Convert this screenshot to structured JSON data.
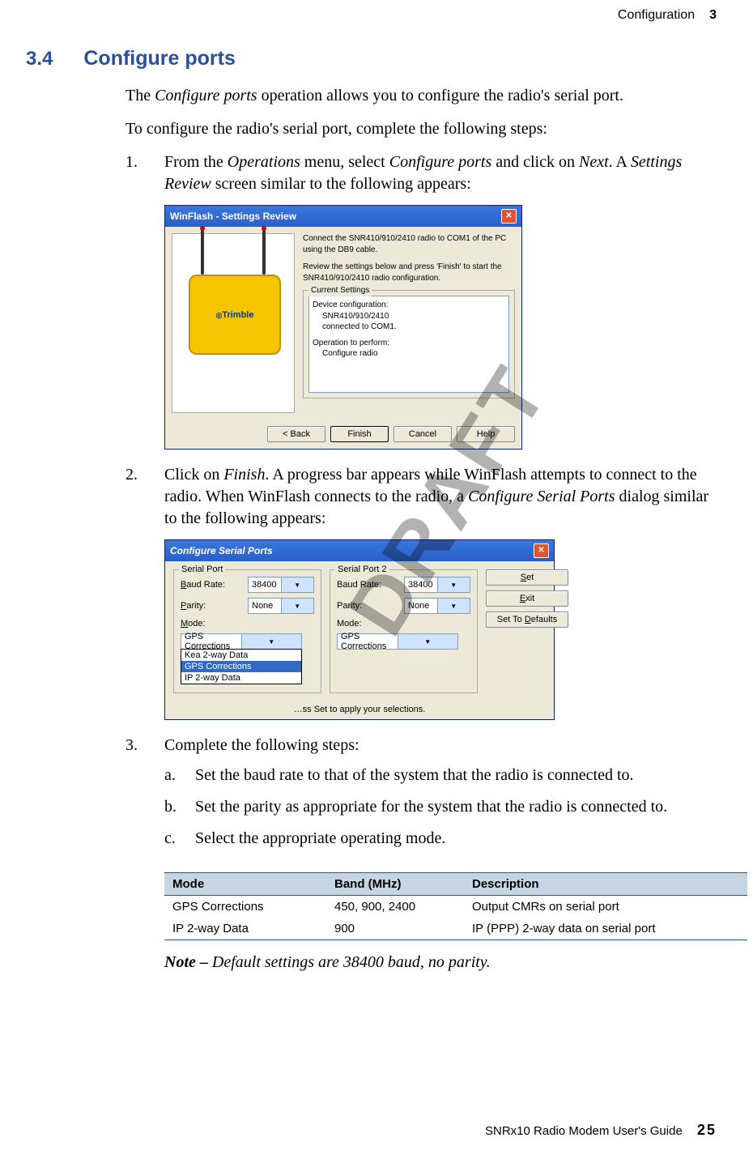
{
  "header": {
    "chapter_name": "Configuration",
    "chapter_num": "3"
  },
  "heading": {
    "num": "3.4",
    "title": "Configure ports"
  },
  "intro1_pre": "The ",
  "intro1_em": "Configure ports",
  "intro1_post": " operation allows you to configure the radio's serial port.",
  "intro2": "To configure the radio's serial port, complete the following steps:",
  "step1": {
    "num": "1.",
    "t1": "From the ",
    "em1": "Operations",
    "t2": " menu, select ",
    "em2": "Configure ports",
    "t3": " and click on ",
    "em3": "Next",
    "t4": ". A ",
    "em4": "Settings Review",
    "t5": " screen similar to the following appears:"
  },
  "dlg1": {
    "title": "WinFlash - Settings Review",
    "p1": "Connect the SNR410/910/2410 radio to COM1 of the PC using the DB9 cable.",
    "p2": "Review the settings below and press 'Finish' to start the SNR410/910/2410 radio configuration.",
    "cs_legend": "Current Settings",
    "cs_l1": "Device configuration:",
    "cs_l2": "SNR410/910/2410",
    "cs_l3": "connected to COM1.",
    "cs_l4": "Operation to perform:",
    "cs_l5": "Configure radio",
    "device_brand": "Trimble",
    "btn_back": "< Back",
    "btn_finish": "Finish",
    "btn_cancel": "Cancel",
    "btn_help": "Help"
  },
  "step2": {
    "num": "2.",
    "t1": "Click on ",
    "em1": "Finish",
    "t2": ". A progress bar appears while WinFlash attempts to connect to the radio. When WinFlash connects to the radio, a ",
    "em2": "Configure Serial Ports",
    "t3": " dialog similar to the following appears:"
  },
  "dlg2": {
    "title": "Configure Serial Ports",
    "sp1_legend": "Serial Port",
    "sp2_legend": "Serial Port 2",
    "baud_label_pre": "B",
    "baud_label_post": "aud Rate:",
    "parity_label_pre": "P",
    "parity_label_post": "arity:",
    "mode_label_pre": "M",
    "mode_label_post": "ode:",
    "baud_val": "38400",
    "parity_val": "None",
    "mode_val": "GPS Corrections",
    "opt1": "Kea 2-way Data",
    "opt2": "GPS Corrections",
    "opt3": "IP 2-way Data",
    "btn_set_pre": "S",
    "btn_set_post": "et",
    "btn_exit_pre": "E",
    "btn_exit_post": "xit",
    "btn_def_pre": "Set To ",
    "btn_def_u": "D",
    "btn_def_post": "efaults",
    "footnote": "…ss Set to apply your selections."
  },
  "step3": {
    "num": "3.",
    "text": "Complete the following steps:",
    "a": {
      "num": "a.",
      "text": "Set the baud rate to that of the system that the radio is connected to."
    },
    "b": {
      "num": "b.",
      "text": "Set the parity as appropriate for the system that the radio is connected to."
    },
    "c": {
      "num": "c.",
      "text": "Select the appropriate operating mode."
    }
  },
  "table": {
    "h_mode": "Mode",
    "h_band": "Band (MHz)",
    "h_desc": "Description",
    "rows": [
      {
        "mode": "GPS Corrections",
        "band": "450, 900, 2400",
        "desc": "Output CMRs on serial port"
      },
      {
        "mode": "IP 2-way Data",
        "band": "900",
        "desc": "IP (PPP) 2-way data on serial port"
      }
    ]
  },
  "note": {
    "label": "Note – ",
    "text": "Default settings are 38400 baud, no parity."
  },
  "footer": {
    "text": "SNRx10 Radio Modem User's Guide",
    "page": "25"
  },
  "watermark": "DRAFT"
}
